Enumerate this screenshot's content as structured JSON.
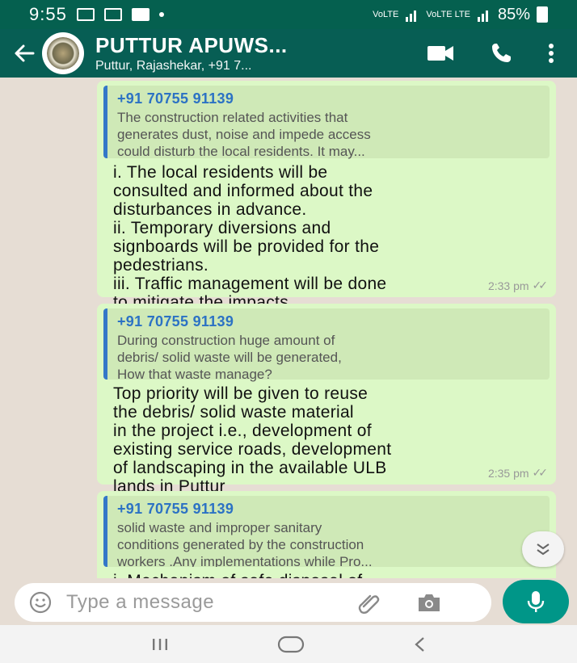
{
  "status_bar": {
    "time": "9:55",
    "network_1": "VoLTE",
    "network_2": "VoLTE LTE",
    "battery": "85%"
  },
  "header": {
    "title": "PUTTUR APUWS...",
    "subtitle": "Puttur, Rajashekar, +91 7...",
    "icons": [
      "back-arrow-icon",
      "group-avatar",
      "video-call-icon",
      "phone-icon",
      "more-vert-icon"
    ]
  },
  "messages": [
    {
      "quote_sender": "+91 70755 91139",
      "quote_text": "The construction related activities that\ngenerates dust, noise and impede access\ncould disturb the local residents.  It may...",
      "text": "i. The local residents will be\nconsulted and informed about the\ndisturbances in advance.\nii.  Temporary diversions and\nsignboards will be provided for the\npedestrians.\niii. Traffic management will be done\nto mitigate the impacts.",
      "time": "2:33 pm"
    },
    {
      "quote_sender": "+91 70755 91139",
      "quote_text": "During construction huge amount of\ndebris/ solid waste will be generated,\nHow that waste manage?",
      "text": "Top priority will be given to reuse\nthe debris/ solid waste material\nin the project i.e., development of\nexisting service roads, development\nof landscaping in the available ULB\nlands in Puttur",
      "time": "2:35 pm"
    },
    {
      "quote_sender": "+91 70755 91139",
      "quote_text": "solid waste and improper sanitary\nconditions generated by the construction\nworkers .Any implementations while Pro...",
      "text": "i. Mechanism of safe disposal of"
    }
  ],
  "input": {
    "placeholder": "Type a message"
  },
  "colors": {
    "header": "#075e54",
    "status_bar": "#05604f",
    "bubble": "#dcf8c6",
    "quote_bar": "#3478c8",
    "mic": "#009688",
    "chat_bg": "#e6ddd4"
  }
}
